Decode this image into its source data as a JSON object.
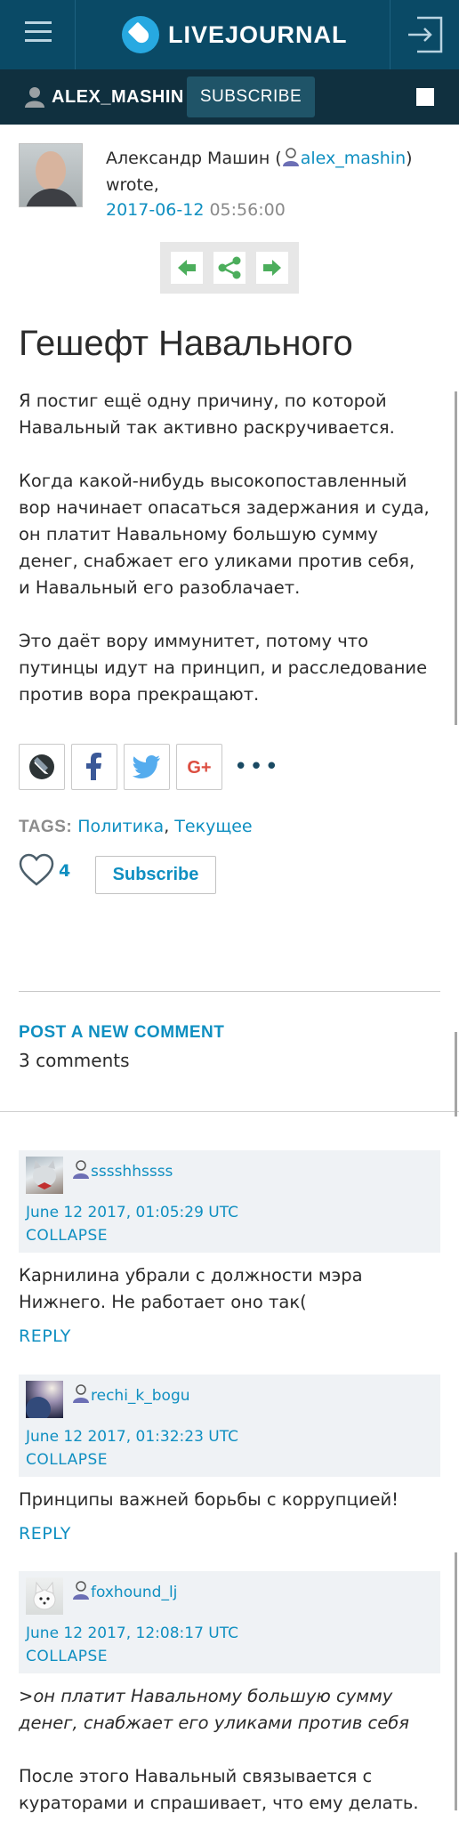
{
  "header": {
    "logo_text": "LIVEJOURNAL",
    "username": "ALEX_MASHIN",
    "subscribe_label": "SUBSCRIBE"
  },
  "post": {
    "author_name": "Александр Машин (",
    "author_handle": "alex_mashin",
    "author_close": ")",
    "wrote": "wrote,",
    "date": "2017-06-12",
    "time": "05:56:00",
    "title": "Гешефт Навального",
    "paragraphs": [
      "Я постиг ещё одну причину, по которой Навальный так активно раскручивается.",
      "Когда какой-нибудь высокопоставленный вор начинает опасаться задержания и суда, он платит Навальному большую сумму денег, снабжает его уликами против себя,",
      "и Навальный его разоблачает.",
      "Это даёт вору иммунитет, потому что путинцы идут на принцип, и расследование против вора прекращают."
    ],
    "tags_label": "TAGS:",
    "tags": [
      "Политика",
      "Текущее"
    ],
    "tags_sep": ",",
    "like_count": "4",
    "subscribe_label": "Subscribe"
  },
  "share": {
    "icons": [
      "livejournal-icon",
      "facebook-icon",
      "twitter-icon",
      "google-plus-icon",
      "more-icon"
    ],
    "more_label": "•••",
    "gplus_label": "G+"
  },
  "comments_section": {
    "post_label": "POST A NEW COMMENT",
    "count_label": "3 comments"
  },
  "comments": [
    {
      "user": "sssshhssss",
      "date": "June 12 2017, 01:05:29 UTC",
      "collapse": "COLLAPSE",
      "text": "Карнилина убрали с должности мэра Нижнего. Не работает оно так(",
      "reply": "REPLY"
    },
    {
      "user": "rechi_k_bogu",
      "date": "June 12 2017, 01:32:23 UTC",
      "collapse": "COLLAPSE",
      "text": "Принципы важней борьбы с коррупцией!",
      "reply": "REPLY"
    },
    {
      "user": "foxhound_lj",
      "date": "June 12 2017, 12:08:17 UTC",
      "collapse": "COLLAPSE",
      "text_quote": ">он платит Навальному большую сумму денег, снабжает его уликами против себя",
      "text": "После этого Навальный связывается с кураторами и спрашивает, что ему делать."
    }
  ],
  "colors": {
    "topbar": "#0a4a66",
    "userbar": "#10303f",
    "link": "#0f8fc1",
    "comment_bg": "#eff2f5"
  }
}
